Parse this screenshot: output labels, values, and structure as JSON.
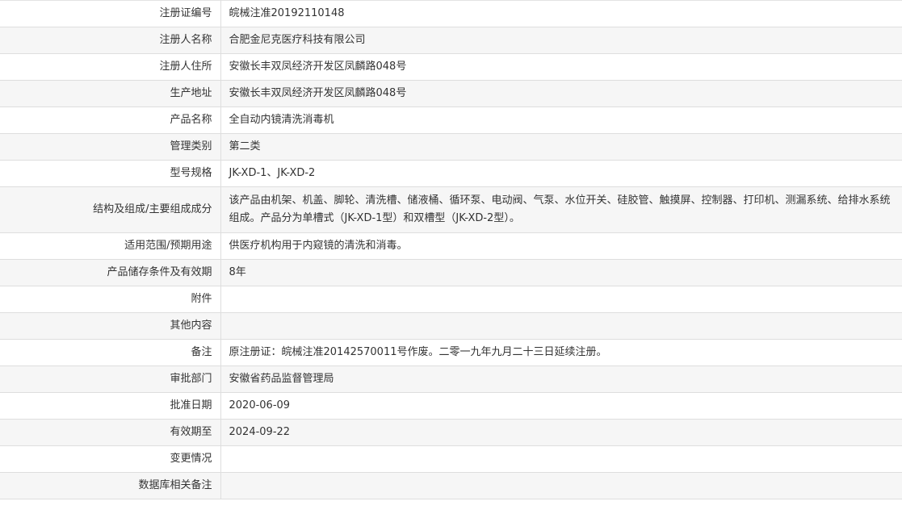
{
  "rows": [
    {
      "label": "注册证编号",
      "value": "皖械注准20192110148"
    },
    {
      "label": "注册人名称",
      "value": "合肥金尼克医疗科技有限公司"
    },
    {
      "label": "注册人住所",
      "value": "安徽长丰双凤经济开发区凤麟路048号"
    },
    {
      "label": "生产地址",
      "value": "安徽长丰双凤经济开发区凤麟路048号"
    },
    {
      "label": "产品名称",
      "value": "全自动内镜清洗消毒机"
    },
    {
      "label": "管理类别",
      "value": "第二类"
    },
    {
      "label": "型号规格",
      "value": "JK-XD-1、JK-XD-2"
    },
    {
      "label": "结构及组成/主要组成成分",
      "value": "该产品由机架、机盖、脚轮、清洗槽、储液桶、循环泵、电动阀、气泵、水位开关、硅胶管、触摸屏、控制器、打印机、测漏系统、给排水系统组成。产品分为单槽式（JK-XD-1型）和双槽型（JK-XD-2型）。"
    },
    {
      "label": "适用范围/预期用途",
      "value": "供医疗机构用于内窥镜的清洗和消毒。"
    },
    {
      "label": "产品储存条件及有效期",
      "value": "8年"
    },
    {
      "label": "附件",
      "value": ""
    },
    {
      "label": "其他内容",
      "value": ""
    },
    {
      "label": "备注",
      "value": "原注册证：皖械注准20142570011号作废。二零一九年九月二十三日延续注册。"
    },
    {
      "label": "审批部门",
      "value": "安徽省药品监督管理局"
    },
    {
      "label": "批准日期",
      "value": "2020-06-09"
    },
    {
      "label": "有效期至",
      "value": "2024-09-22"
    },
    {
      "label": "变更情况",
      "value": ""
    },
    {
      "label": "数据库相关备注",
      "value": ""
    }
  ]
}
